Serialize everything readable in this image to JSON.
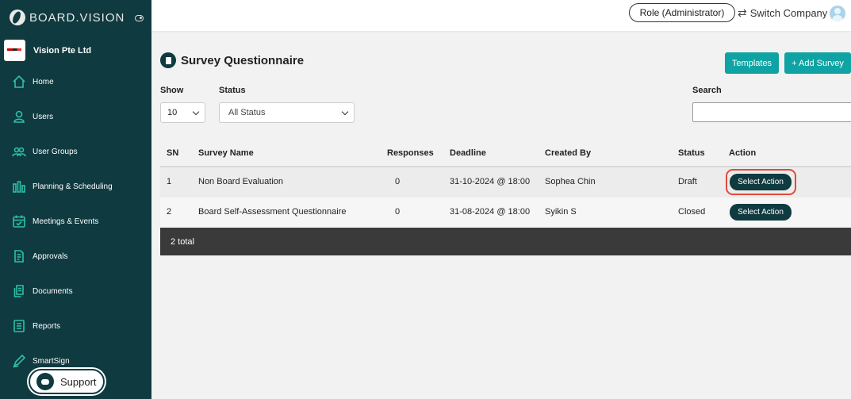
{
  "brand": {
    "name": "BOARD.VISION"
  },
  "company": {
    "name": "Vision Pte Ltd"
  },
  "nav": [
    {
      "label": "Home",
      "icon": "home-icon"
    },
    {
      "label": "Users",
      "icon": "user-icon"
    },
    {
      "label": "User Groups",
      "icon": "users-icon"
    },
    {
      "label": "Planning & Scheduling",
      "icon": "bar-chart-icon"
    },
    {
      "label": "Meetings & Events",
      "icon": "calendar-icon"
    },
    {
      "label": "Approvals",
      "icon": "document-check-icon"
    },
    {
      "label": "Documents",
      "icon": "documents-icon"
    },
    {
      "label": "Reports",
      "icon": "list-icon"
    },
    {
      "label": "SmartSign",
      "icon": "pen-icon"
    }
  ],
  "support": {
    "label": "Support"
  },
  "header": {
    "role": "Role (Administrator)",
    "switch_company": "Switch Company"
  },
  "page": {
    "title": "Survey Questionnaire",
    "templates_label": "Templates",
    "add_label": "+ Add Survey",
    "show_label": "Show",
    "show_value": "10",
    "status_label": "Status",
    "status_value": "All Status",
    "search_label": "Search"
  },
  "table": {
    "headers": {
      "sn": "SN",
      "name": "Survey Name",
      "responses": "Responses",
      "deadline": "Deadline",
      "created_by": "Created By",
      "status": "Status",
      "action": "Action"
    },
    "rows": [
      {
        "sn": "1",
        "name": "Non Board Evaluation",
        "responses": "0",
        "deadline": "31-10-2024 @ 18:00",
        "created_by": "Sophea Chin",
        "status": "Draft",
        "action": "Select Action"
      },
      {
        "sn": "2",
        "name": "Board Self-Assessment Questionnaire",
        "responses": "0",
        "deadline": "31-08-2024 @ 18:00",
        "created_by": "Syikin S",
        "status": "Closed",
        "action": "Select Action"
      }
    ],
    "footer": "2 total"
  },
  "colors": {
    "sidebar": "#0f3a40",
    "accent": "#10a3a3",
    "highlight": "#e14b3b"
  }
}
